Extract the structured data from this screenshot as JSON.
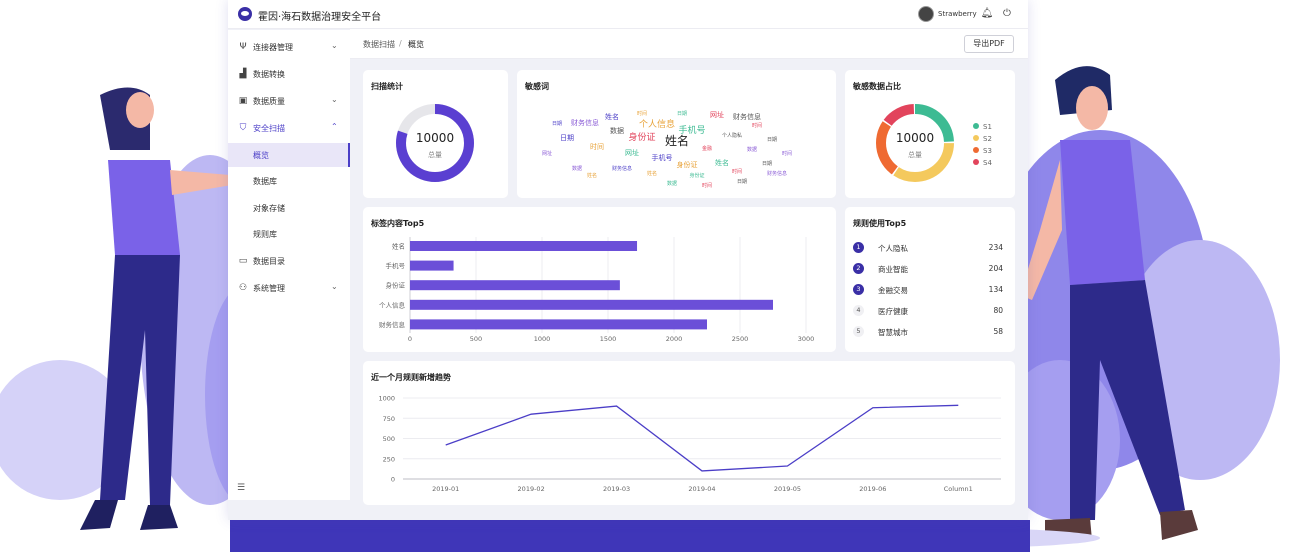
{
  "app": {
    "title": "霍因·海石数据治理安全平台",
    "user_name": "Strawberry"
  },
  "sidebar": {
    "items": [
      {
        "label": "连接器管理",
        "icon": "usb-icon",
        "chevron": "⌄"
      },
      {
        "label": "数据转换",
        "icon": "chart-bars-icon"
      },
      {
        "label": "数据质量",
        "icon": "folder-gear-icon",
        "chevron": "⌄"
      },
      {
        "label": "安全扫描",
        "icon": "shield-icon",
        "chevron": "⌃"
      },
      {
        "label": "概览"
      },
      {
        "label": "数据库"
      },
      {
        "label": "对象存储"
      },
      {
        "label": "规则库"
      },
      {
        "label": "数据目录",
        "icon": "folder-icon"
      },
      {
        "label": "系统管理",
        "icon": "users-icon",
        "chevron": "⌄"
      }
    ]
  },
  "breadcrumb": {
    "parent": "数据扫描",
    "separator": "/",
    "current": "概览"
  },
  "toolbar": {
    "export_label": "导出PDF"
  },
  "scan_stats": {
    "title": "扫描统计",
    "total_value": "10000",
    "total_label": "总量",
    "fill_fraction": 0.8
  },
  "sensitive_words": {
    "title": "敏感词",
    "words": [
      {
        "text": "姓名",
        "tier": 3
      },
      {
        "text": "个人信息",
        "tier": 2
      },
      {
        "text": "手机号",
        "tier": 2
      },
      {
        "text": "身份证",
        "tier": 2
      },
      {
        "text": "数据",
        "tier": 1
      },
      {
        "text": "财务信息",
        "tier": 1
      },
      {
        "text": "日期",
        "tier": 1
      },
      {
        "text": "时间",
        "tier": 1
      },
      {
        "text": "网址",
        "tier": 1
      },
      {
        "text": "金融",
        "tier": 0
      },
      {
        "text": "个人隐私",
        "tier": 0
      },
      {
        "text": "数据",
        "tier": 0
      },
      {
        "text": "手机号",
        "tier": 1
      },
      {
        "text": "身份证",
        "tier": 1
      },
      {
        "text": "姓名",
        "tier": 1
      },
      {
        "text": "时间",
        "tier": 0
      },
      {
        "text": "日期",
        "tier": 0
      },
      {
        "text": "网址",
        "tier": 0
      },
      {
        "text": "财务信息",
        "tier": 0
      },
      {
        "text": "姓名",
        "tier": 0
      },
      {
        "text": "身份证",
        "tier": 0
      },
      {
        "text": "时间",
        "tier": 0
      },
      {
        "text": "日期",
        "tier": 0
      },
      {
        "text": "数据",
        "tier": 0
      },
      {
        "text": "姓名",
        "tier": 1
      },
      {
        "text": "时间",
        "tier": 0
      },
      {
        "text": "日期",
        "tier": 0
      },
      {
        "text": "网址",
        "tier": 1
      },
      {
        "text": "财务信息",
        "tier": 1
      },
      {
        "text": "时间",
        "tier": 0
      },
      {
        "text": "日期",
        "tier": 0
      },
      {
        "text": "姓名",
        "tier": 0
      },
      {
        "text": "数据",
        "tier": 0
      },
      {
        "text": "时间",
        "tier": 0
      },
      {
        "text": "日期",
        "tier": 0
      },
      {
        "text": "财务信息",
        "tier": 0
      }
    ],
    "colors": [
      "#4b3ec7",
      "#e8a33a",
      "#3dbb93",
      "#e2445c",
      "#555555",
      "#8a5bd6"
    ]
  },
  "sensitive_ratio": {
    "title": "敏感数据占比",
    "total_value": "10000",
    "total_label": "总量",
    "legend": [
      {
        "name": "S1",
        "color": "#3dbb93",
        "value": 0.25
      },
      {
        "name": "S2",
        "color": "#f4c95d",
        "value": 0.35
      },
      {
        "name": "S3",
        "color": "#ef6a32",
        "value": 0.25
      },
      {
        "name": "S4",
        "color": "#e2445c",
        "value": 0.15
      }
    ]
  },
  "rules_top5": {
    "title": "规则使用Top5",
    "items": [
      {
        "rank": "1",
        "name": "个人隐私",
        "count": "234",
        "highlight": true
      },
      {
        "rank": "2",
        "name": "商业智能",
        "count": "204",
        "highlight": true
      },
      {
        "rank": "3",
        "name": "金融交易",
        "count": "134",
        "highlight": true
      },
      {
        "rank": "4",
        "name": "医疗健康",
        "count": "80",
        "highlight": false
      },
      {
        "rank": "5",
        "name": "智慧城市",
        "count": "58",
        "highlight": false
      }
    ]
  },
  "chart_data": [
    {
      "type": "bar",
      "orientation": "horizontal",
      "title": "标签内容Top5",
      "categories": [
        "姓名",
        "手机号",
        "身份证",
        "个人信息",
        "财务信息"
      ],
      "values": [
        1720,
        330,
        1590,
        2750,
        2250
      ],
      "xlim": [
        0,
        3000
      ],
      "xticks": [
        "0",
        "500",
        "1000",
        "1500",
        "2000",
        "2500",
        "3000"
      ],
      "grid": true,
      "color": "#6b4fd8"
    },
    {
      "type": "line",
      "title": "近一个月规则新增趋势",
      "categories": [
        "2019-01",
        "2019-02",
        "2019-03",
        "2019-04",
        "2019-05",
        "2019-06",
        "Column1"
      ],
      "values": [
        420,
        800,
        900,
        100,
        160,
        880,
        910
      ],
      "ylim": [
        0,
        1000
      ],
      "yticks": [
        "0",
        "250",
        "500",
        "750",
        "1000"
      ],
      "grid": true,
      "color": "#4b3ec7"
    }
  ]
}
